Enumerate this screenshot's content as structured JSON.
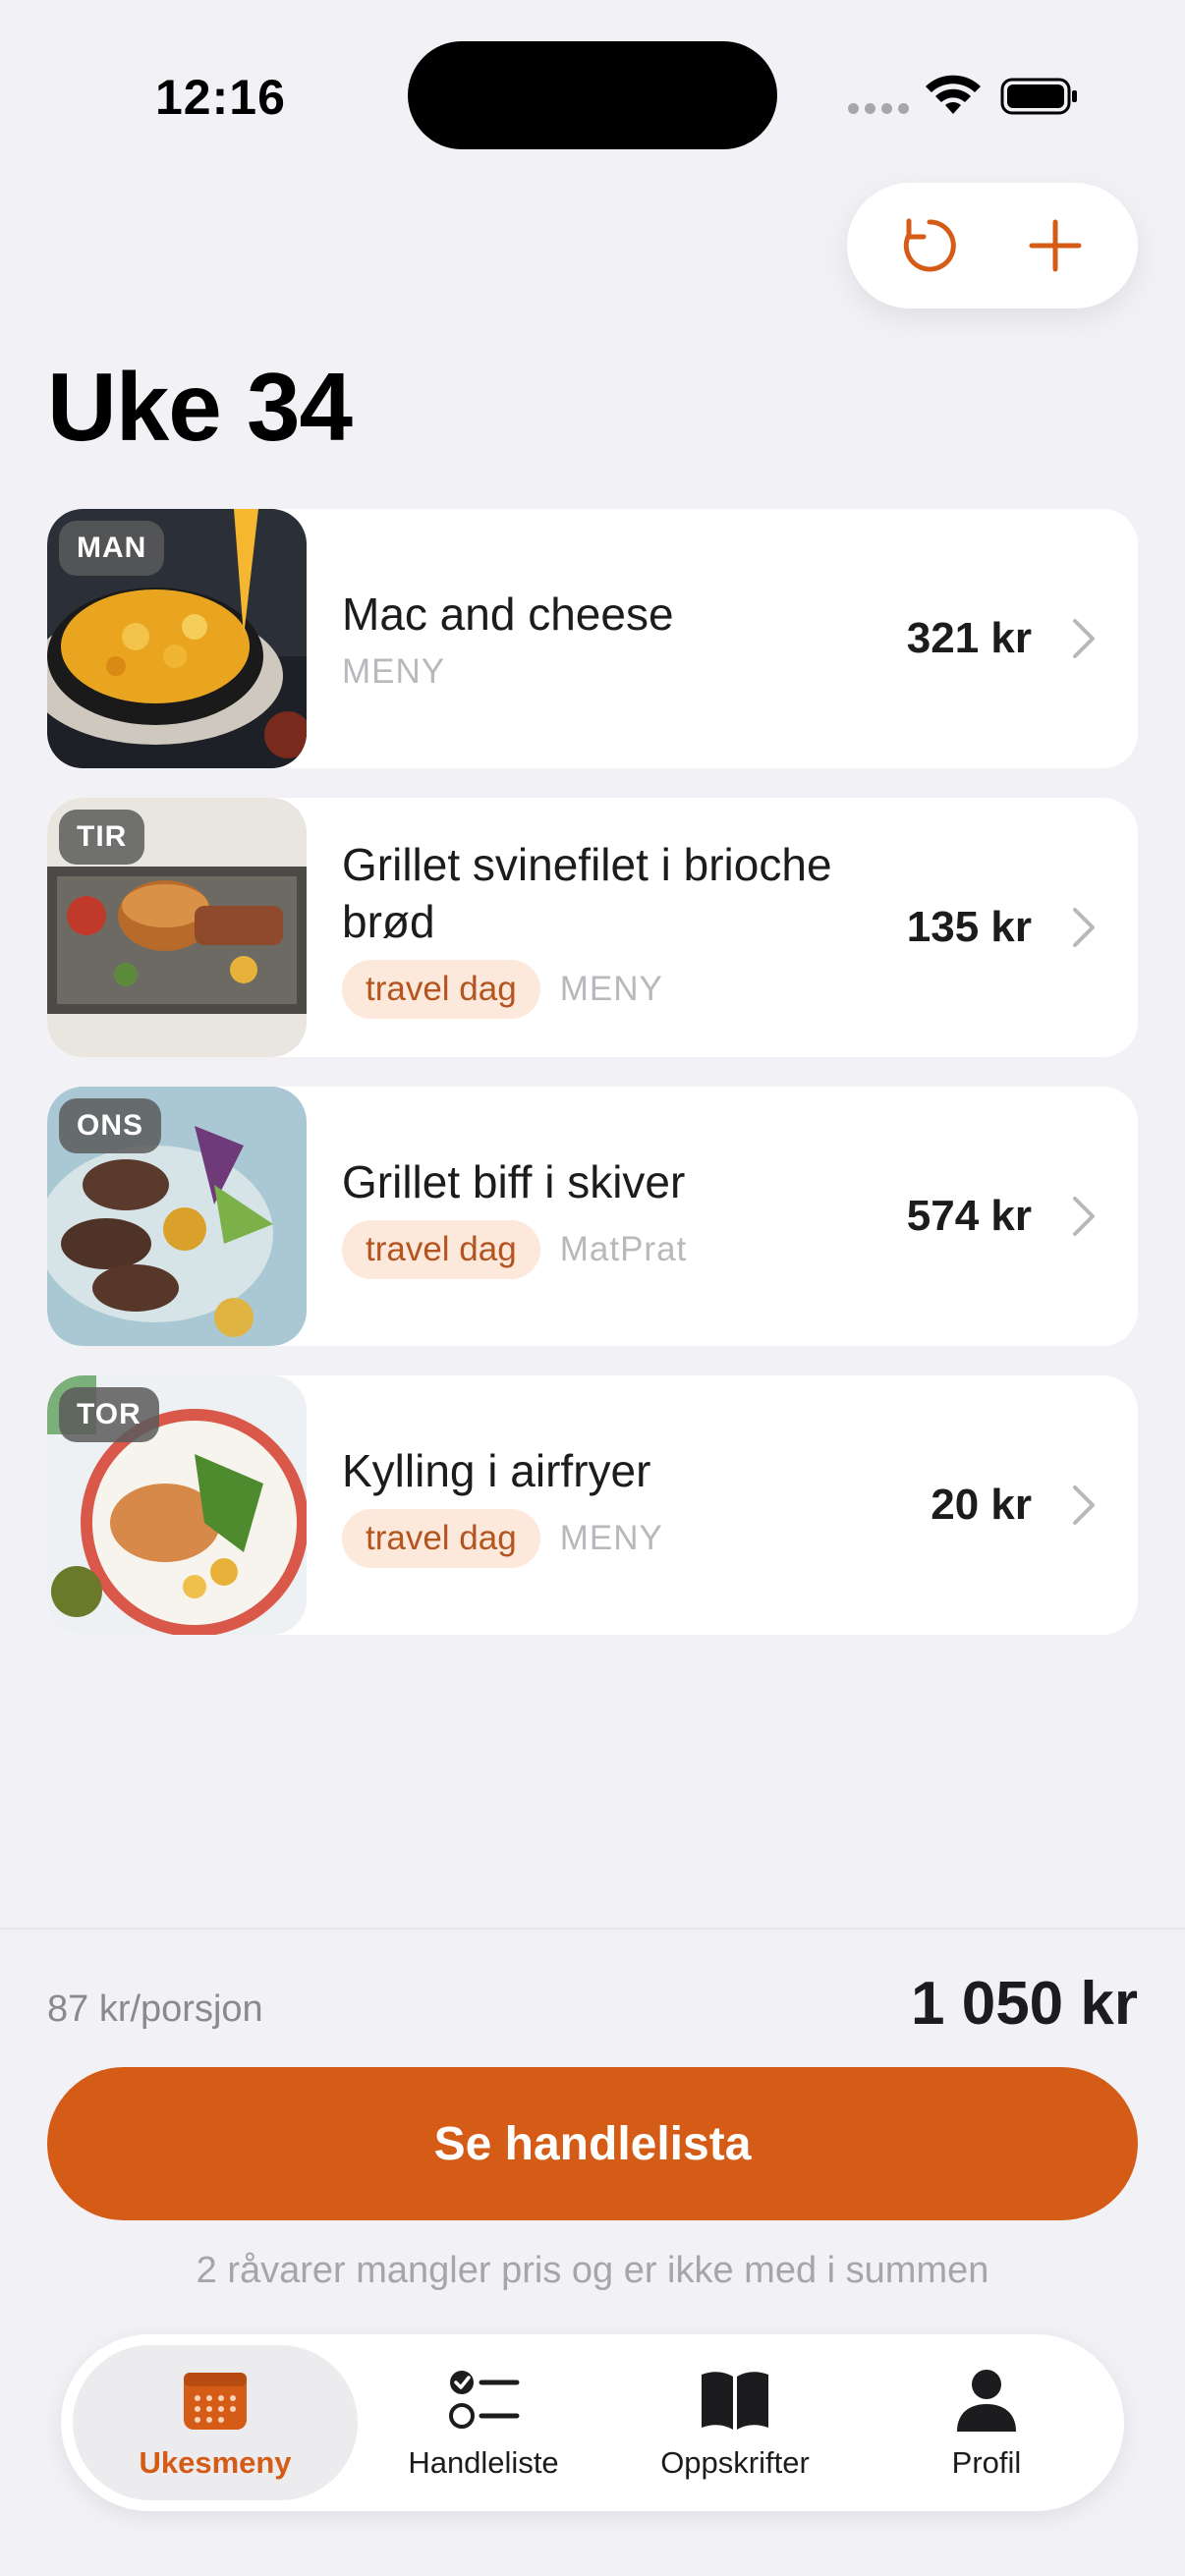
{
  "status": {
    "time": "12:16"
  },
  "header": {
    "title": "Uke 34"
  },
  "actions": {
    "refresh_icon": "refresh-icon",
    "add_icon": "plus-icon"
  },
  "meals": [
    {
      "day": "MAN",
      "title": "Mac and cheese",
      "tag": "",
      "source": "MENY",
      "price": "321 kr"
    },
    {
      "day": "TIR",
      "title": "Grillet svinefilet i brioche brød",
      "tag": "travel dag",
      "source": "MENY",
      "price": "135 kr"
    },
    {
      "day": "ONS",
      "title": "Grillet biff i skiver",
      "tag": "travel dag",
      "source": "MatPrat",
      "price": "574 kr"
    },
    {
      "day": "TOR",
      "title": "Kylling i airfryer",
      "tag": "travel dag",
      "source": "MENY",
      "price": "20 kr"
    }
  ],
  "summary": {
    "per_portion": "87 kr/porsjon",
    "total": "1 050 kr",
    "cta_label": "Se handlelista",
    "missing_note": "2 råvarer mangler pris og er ikke med i summen"
  },
  "tabs": [
    {
      "label": "Ukesmeny",
      "icon": "calendar-icon",
      "active": true
    },
    {
      "label": "Handleliste",
      "icon": "checklist-icon",
      "active": false
    },
    {
      "label": "Oppskrifter",
      "icon": "book-icon",
      "active": false
    },
    {
      "label": "Profil",
      "icon": "person-icon",
      "active": false
    }
  ],
  "colors": {
    "accent": "#d45c16",
    "tag_bg": "#fde8dc",
    "tag_text": "#b4551f",
    "background": "#f2f2f6"
  }
}
